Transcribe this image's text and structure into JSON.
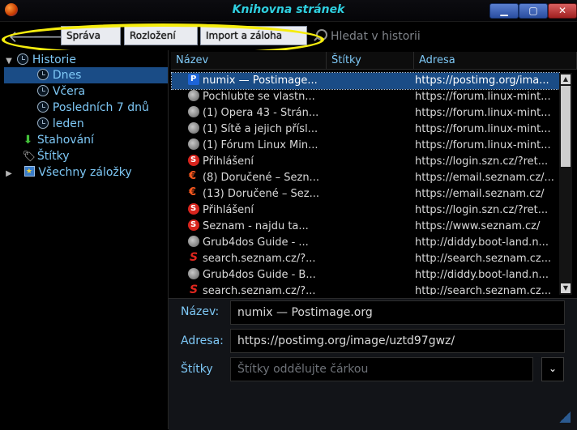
{
  "window": {
    "title": "Knihovna stránek"
  },
  "toolbar": {
    "manage_label": "Správa",
    "layout_label": "Rozložení",
    "import_label": "Import a záloha",
    "search_placeholder": "Hledat v historii"
  },
  "sidebar": {
    "items": [
      {
        "label": "Historie"
      },
      {
        "label": "Dnes"
      },
      {
        "label": "Včera"
      },
      {
        "label": "Posledních 7 dnů"
      },
      {
        "label": "leden"
      },
      {
        "label": "Stahování"
      },
      {
        "label": "Štítky"
      },
      {
        "label": "Všechny záložky"
      }
    ]
  },
  "table": {
    "columns": [
      "Název",
      "Štítky",
      "Adresa"
    ],
    "rows": [
      {
        "name": "numix — Postimage...",
        "url": "https://postimg.org/ima...",
        "icon": "postimage-icon"
      },
      {
        "name": "Pochlubte se vlastn...",
        "url": "https://forum.linux-mint...",
        "icon": "globe-icon"
      },
      {
        "name": "(1) Opera 43 - Strán...",
        "url": "https://forum.linux-mint...",
        "icon": "globe-icon"
      },
      {
        "name": "(1) Sítě a jejich přísl...",
        "url": "https://forum.linux-mint...",
        "icon": "globe-icon"
      },
      {
        "name": "(1) Fórum Linux Min...",
        "url": "https://forum.linux-mint...",
        "icon": "globe-icon"
      },
      {
        "name": "Přihlášení",
        "url": "https://login.szn.cz/?ret...",
        "icon": "seznam-icon"
      },
      {
        "name": "(8) Doručené – Sezn...",
        "url": "https://email.seznam.cz/...",
        "icon": "email-icon"
      },
      {
        "name": "(13) Doručené – Sez...",
        "url": "https://email.seznam.cz/",
        "icon": "email-icon"
      },
      {
        "name": "Přihlášení",
        "url": "https://login.szn.cz/?ret...",
        "icon": "seznam-icon"
      },
      {
        "name": "Seznam - najdu ta...",
        "url": "https://www.seznam.cz/",
        "icon": "seznam-icon"
      },
      {
        "name": "Grub4dos Guide - ...",
        "url": "http://diddy.boot-land.n...",
        "icon": "globe-icon"
      },
      {
        "name": "search.seznam.cz/?...",
        "url": "http://search.seznam.cz...",
        "icon": "seznam-search-icon"
      },
      {
        "name": "Grub4dos Guide - B...",
        "url": "http://diddy.boot-land.n...",
        "icon": "globe-icon"
      },
      {
        "name": "search.seznam.cz/?...",
        "url": "http://search.seznam.cz...",
        "icon": "seznam-search-icon"
      }
    ]
  },
  "details": {
    "name_label": "Název:",
    "name_value": "numix — Postimage.org",
    "address_label": "Adresa:",
    "address_value": "https://postimg.org/image/uztd97gwz/",
    "tags_label": "Štítky",
    "tags_placeholder": "Štítky oddělujte čárkou"
  },
  "colors": {
    "accent": "#7ec8f6",
    "selection": "#1a4c86",
    "highlight": "#f5ec0e",
    "title": "#2fd0e0"
  }
}
